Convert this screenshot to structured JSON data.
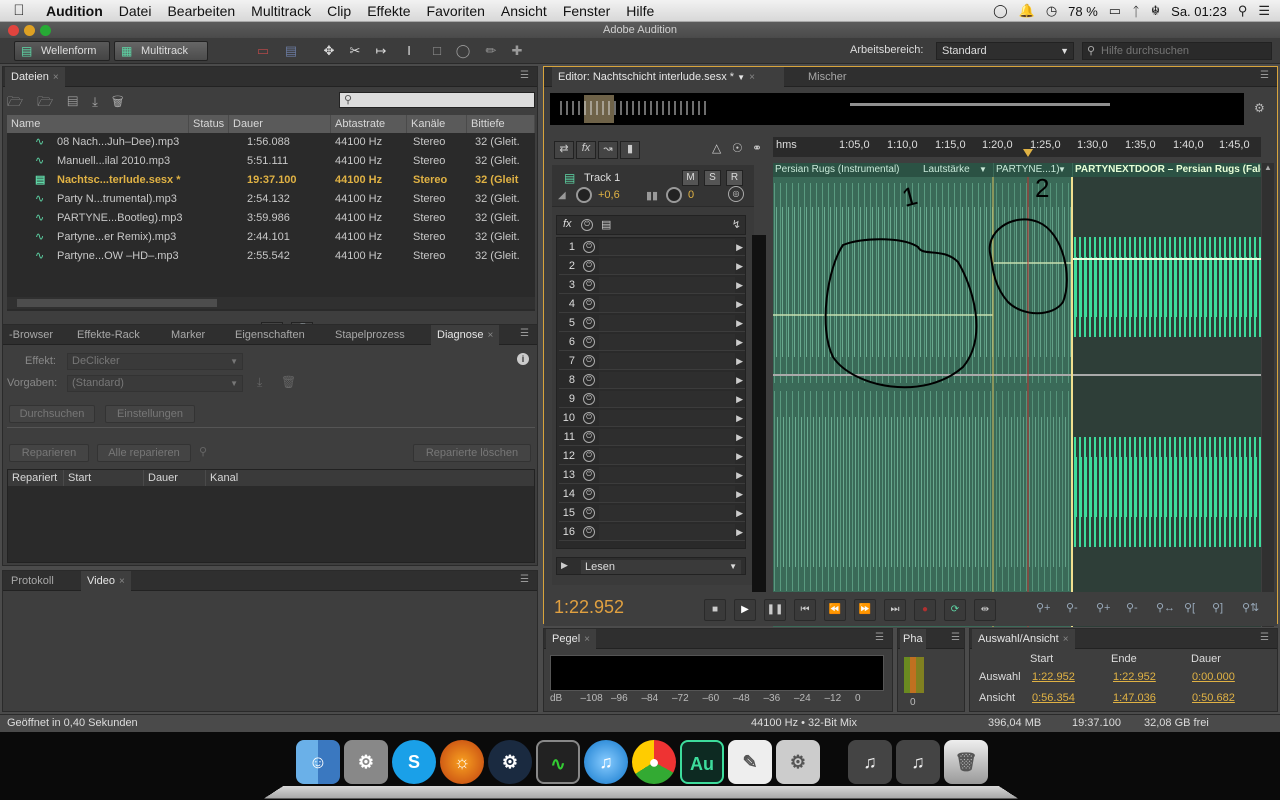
{
  "menubar": {
    "apple": "",
    "app_name": "Audition",
    "items": [
      "Datei",
      "Bearbeiten",
      "Multitrack",
      "Clip",
      "Effekte",
      "Favoriten",
      "Ansicht",
      "Fenster",
      "Hilfe"
    ],
    "battery": "78 %",
    "clock": "Sa. 01:23"
  },
  "window": {
    "title": "Adobe Audition"
  },
  "toolbar": {
    "waveform_label": "Wellenform",
    "multitrack_label": "Multitrack",
    "workspace_label": "Arbeitsbereich:",
    "workspace_value": "Standard",
    "help_placeholder": "Hilfe durchsuchen"
  },
  "files_panel": {
    "tab": "Dateien",
    "columns": [
      "Name",
      "Status",
      "Dauer",
      "Abtastrate",
      "Kanäle",
      "Bittiefe"
    ],
    "rows": [
      {
        "name": "08 Nach...Juh–Dee).mp3",
        "duration": "1:56.088",
        "rate": "44100 Hz",
        "channels": "Stereo",
        "depth": "32 (Gleit."
      },
      {
        "name": "Manuell...ilal 2010.mp3",
        "duration": "5:51.111",
        "rate": "44100 Hz",
        "channels": "Stereo",
        "depth": "32 (Gleit."
      },
      {
        "name": "Nachtsc...terlude.sesx *",
        "duration": "19:37.100",
        "rate": "44100 Hz",
        "channels": "Stereo",
        "depth": "32 (Gleit"
      },
      {
        "name": "Party N...trumental).mp3",
        "duration": "2:54.132",
        "rate": "44100 Hz",
        "channels": "Stereo",
        "depth": "32 (Gleit."
      },
      {
        "name": "PARTYNE...Bootleg).mp3",
        "duration": "3:59.986",
        "rate": "44100 Hz",
        "channels": "Stereo",
        "depth": "32 (Gleit."
      },
      {
        "name": "Partyne...er Remix).mp3",
        "duration": "2:44.101",
        "rate": "44100 Hz",
        "channels": "Stereo",
        "depth": "32 (Gleit."
      },
      {
        "name": "Partyne...OW –HD–.mp3",
        "duration": "2:55.542",
        "rate": "44100 Hz",
        "channels": "Stereo",
        "depth": "32 (Gleit."
      }
    ]
  },
  "diag_panel": {
    "tabs": [
      "-Browser",
      "Effekte-Rack",
      "Marker",
      "Eigenschaften",
      "Stapelprozess",
      "Diagnose"
    ],
    "effect_label": "Effekt:",
    "effect_value": "DeClicker",
    "preset_label": "Vorgaben:",
    "preset_value": "(Standard)",
    "scan_button": "Durchsuchen",
    "settings_button": "Einstellungen",
    "repair_button": "Reparieren",
    "repair_all_button": "Alle reparieren",
    "clear_button": "Reparierte löschen",
    "columns": [
      "Repariert",
      "Start",
      "Dauer",
      "Kanal"
    ]
  },
  "bottom_left": {
    "tabs": [
      "Protokoll",
      "Video"
    ]
  },
  "editor": {
    "tab": "Editor: Nachtschicht interlude.sesx *",
    "mixer_tab": "Mischer",
    "track_name": "Track 1",
    "mute": "M",
    "solo": "S",
    "record": "R",
    "volume": "+0,6",
    "pan": "0",
    "fx_slots": [
      "1",
      "2",
      "3",
      "4",
      "5",
      "6",
      "7",
      "8",
      "9",
      "10",
      "11",
      "12",
      "13",
      "14",
      "15",
      "16"
    ],
    "read_mode": "Lesen",
    "ruler_unit": "hms",
    "ruler_ticks": [
      "1:05,0",
      "1:10,0",
      "1:15,0",
      "1:20,0",
      "1:25,0",
      "1:30,0",
      "1:35,0",
      "1:40,0",
      "1:45,0"
    ],
    "clip1_name": "Persian Rugs (Instrumental)",
    "clip1_param": "Lautstärke",
    "clip2_name": "PARTYNE...1)",
    "clip3_name": "PARTYNEXTDOOR – Persian Rugs (Falcons",
    "time": "1:22.952",
    "annotations": [
      "1",
      "2"
    ]
  },
  "level_panel": {
    "tab": "Pegel",
    "scale": [
      "dB",
      "–108",
      "–96",
      "–84",
      "–72",
      "–60",
      "–48",
      "–36",
      "–24",
      "–12",
      "0"
    ]
  },
  "phase_panel": {
    "tab": "Pha",
    "scale": "0"
  },
  "selection_panel": {
    "tab": "Auswahl/Ansicht",
    "headers": [
      "Start",
      "Ende",
      "Dauer"
    ],
    "selection_label": "Auswahl",
    "selection": [
      "1:22.952",
      "1:22.952",
      "0:00.000"
    ],
    "view_label": "Ansicht",
    "view": [
      "0:56.354",
      "1:47.036",
      "0:50.682"
    ]
  },
  "statusbar": {
    "left": "Geöffnet in 0,40 Sekunden",
    "format": "44100 Hz • 32-Bit Mix",
    "memory": "396,04 MB",
    "duration": "19:37.100",
    "free": "32,08 GB frei"
  },
  "dock": {
    "icons": [
      "finder-icon",
      "system-preferences-icon",
      "skype-icon",
      "firefox-icon",
      "steam-icon",
      "activity-monitor-icon",
      "itunes-icon",
      "chrome-icon",
      "audition-icon",
      "textedit-icon",
      "utility-icon",
      "music-folder-icon",
      "music-folder-icon",
      "trash-icon"
    ],
    "audition_label": "Au"
  }
}
